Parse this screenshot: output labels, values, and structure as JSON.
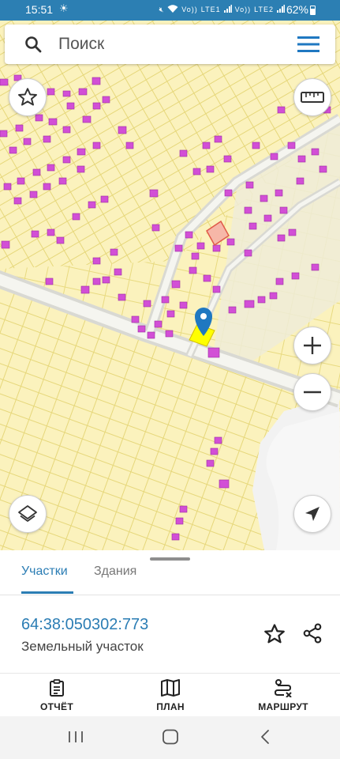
{
  "status_bar": {
    "time": "15:51",
    "network_labels": [
      "Vo))",
      "LTE1",
      "Vo))",
      "LTE2"
    ],
    "battery": "62%"
  },
  "search": {
    "placeholder": "Поиск",
    "value": ""
  },
  "map": {
    "marker": "location-pin-icon",
    "selected_parcel_color": "#ffff00",
    "building_color": "#d24fd6",
    "parcel_fill": "#fbf2bd",
    "controls": [
      "favorite-star-icon",
      "ruler-icon",
      "zoom-in-icon",
      "zoom-out-icon",
      "layers-icon",
      "navigate-arrow-icon"
    ]
  },
  "sheet": {
    "tabs": [
      {
        "label": "Участки",
        "active": true
      },
      {
        "label": "Здания",
        "active": false
      }
    ],
    "cadastral_number": "64:38:050302:773",
    "object_type": "Земельный участок",
    "accent_color": "#2b7db4"
  },
  "bottom_nav": {
    "items": [
      {
        "label": "ОТЧЁТ",
        "icon": "report-icon"
      },
      {
        "label": "ПЛАН",
        "icon": "map-plan-icon"
      },
      {
        "label": "МАРШРУТ",
        "icon": "route-icon"
      }
    ]
  },
  "system_nav": {
    "buttons": [
      "recent-apps-icon",
      "home-icon",
      "back-icon"
    ]
  }
}
